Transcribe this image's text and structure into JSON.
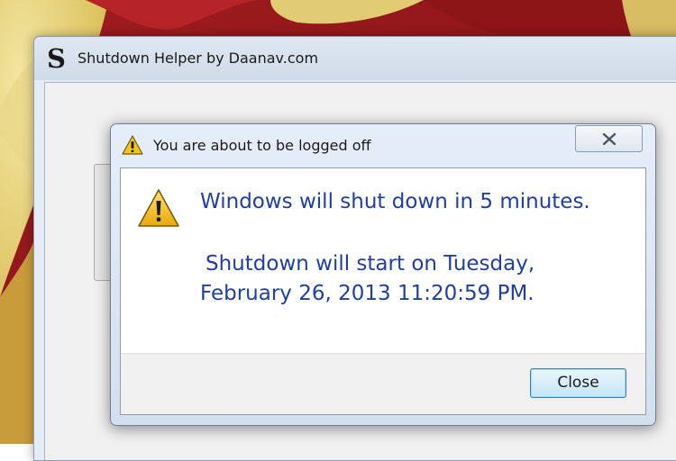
{
  "main_window": {
    "title": "Shutdown Helper by Daanav.com",
    "icon": "S"
  },
  "dialog": {
    "title": "You are about to be logged off",
    "title_icon": "warning-icon",
    "message_icon": "warning-icon",
    "message_line1": "Windows will shut down in 5 minutes.",
    "message_line2": "Shutdown will start on Tuesday,",
    "message_line3": "February 26, 2013 11:20:59 PM.",
    "close_button_label": "Close",
    "titlebar_close_icon": "close-icon"
  },
  "colors": {
    "message_text": "#1e3ea8",
    "wallpaper_red": "#9b1a1c",
    "wallpaper_yellow": "#e9d37a"
  }
}
